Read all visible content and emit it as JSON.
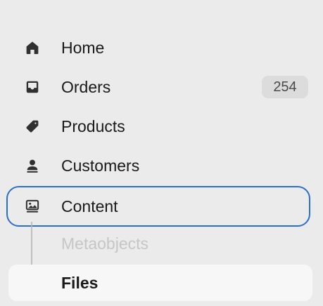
{
  "sidebar": {
    "items": [
      {
        "label": "Home",
        "icon": "home-icon"
      },
      {
        "label": "Orders",
        "icon": "inbox-icon",
        "badge": "254"
      },
      {
        "label": "Products",
        "icon": "tag-icon"
      },
      {
        "label": "Customers",
        "icon": "person-icon"
      },
      {
        "label": "Content",
        "icon": "content-icon",
        "state": "focused"
      }
    ],
    "subitems": [
      {
        "label": "Metaobjects",
        "state": "disabled"
      },
      {
        "label": "Files",
        "state": "selected"
      }
    ]
  },
  "colors": {
    "background": "#ebebeb",
    "focus_ring": "#2c6ecb",
    "selected_bg": "#f7f7f7",
    "badge_bg": "#dcdcdc",
    "disabled_text": "#c6c6c6"
  }
}
